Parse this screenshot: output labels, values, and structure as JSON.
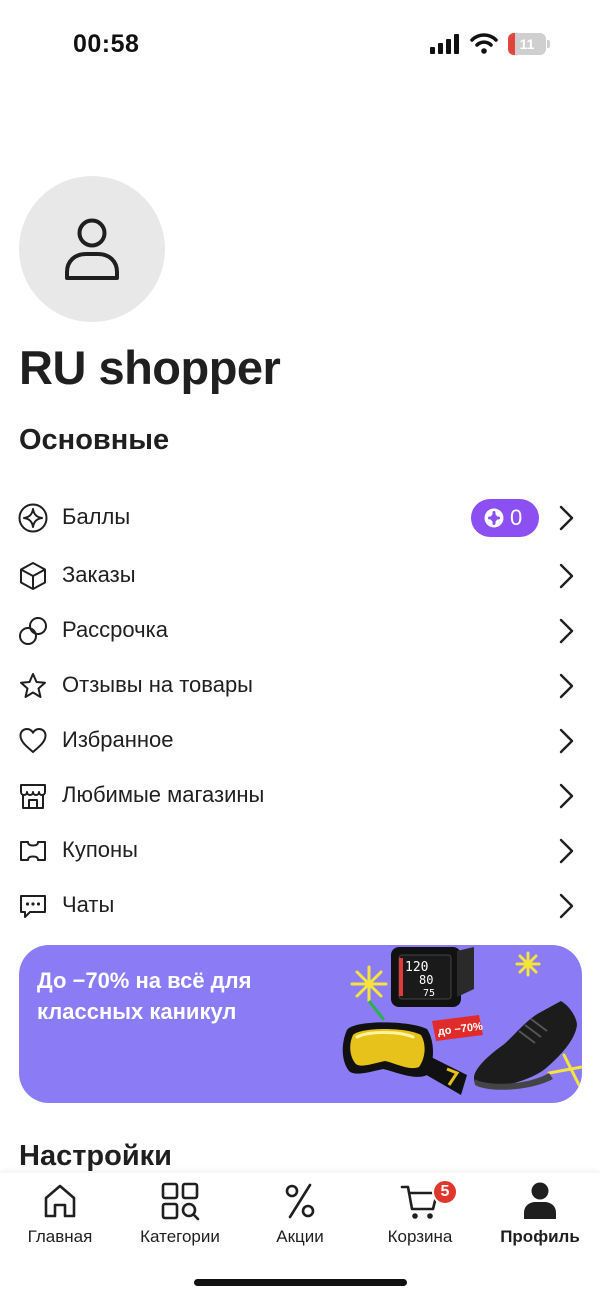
{
  "status_bar": {
    "time": "00:58",
    "battery_level": "11",
    "battery_color": "#e2453c"
  },
  "profile": {
    "username": "RU shopper"
  },
  "sections": {
    "main_title": "Основные",
    "settings_title": "Настройки"
  },
  "menu": {
    "items": [
      {
        "label": "Баллы",
        "icon": "sparkle-circle-icon"
      },
      {
        "label": "Заказы",
        "icon": "box-icon"
      },
      {
        "label": "Рассрочка",
        "icon": "installment-circles-icon"
      },
      {
        "label": "Отзывы на товары",
        "icon": "star-icon"
      },
      {
        "label": "Избранное",
        "icon": "heart-icon"
      },
      {
        "label": "Любимые магазины",
        "icon": "store-icon"
      },
      {
        "label": "Купоны",
        "icon": "coupon-icon"
      },
      {
        "label": "Чаты",
        "icon": "chat-icon"
      }
    ],
    "points_value": "0"
  },
  "banner": {
    "text": "До −70% на всё для классных каникул",
    "tag": "до −70%",
    "device_numbers": [
      "120",
      "80",
      "75"
    ],
    "background": "#8b7cf6"
  },
  "tabs": [
    {
      "label": "Главная",
      "icon": "home-icon"
    },
    {
      "label": "Категории",
      "icon": "categories-icon"
    },
    {
      "label": "Акции",
      "icon": "percent-icon"
    },
    {
      "label": "Корзина",
      "icon": "cart-icon",
      "badge": "5"
    },
    {
      "label": "Профиль",
      "icon": "profile-icon",
      "active": true
    }
  ],
  "colors": {
    "accent": "#8b4ff2",
    "badge": "#e0362b",
    "text": "#1f1f1f"
  }
}
